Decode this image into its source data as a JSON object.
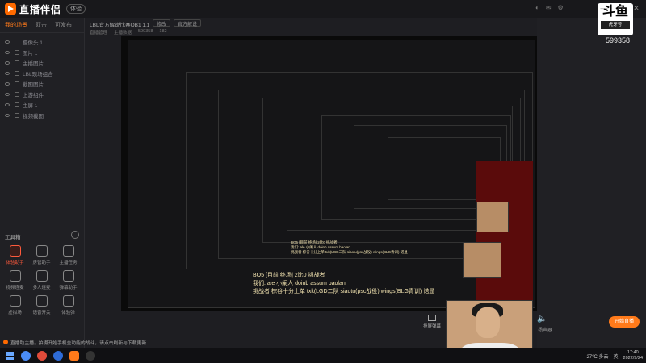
{
  "app": {
    "name": "直播伴侣",
    "badge": "体验",
    "window_controls": [
      "—",
      "□",
      "✕"
    ]
  },
  "left": {
    "tabs": [
      "我的场景",
      "双击",
      "可发布"
    ],
    "scenes": [
      "摄像头 1",
      "图片 1",
      "主播图片",
      "LBL现场组合",
      "截图图片",
      "上游组件",
      "主屏 1",
      "视频截图"
    ],
    "toolbox_title": "工具箱",
    "tools": [
      "体验助手",
      "房管助手",
      "主播任务",
      "视频连麦",
      "多人连麦",
      "弹幕助手",
      "虚拟场",
      "语音开关",
      "体验弹"
    ]
  },
  "center": {
    "room_title": "LBL官方解说比赛OB1 1.1",
    "room_btn1": "修改",
    "room_btn2": "官方解说",
    "room_sub": [
      "直播管理",
      "主播数据",
      "599358",
      "182"
    ],
    "overlay_lines": [
      "BO5 [目前 终场] 2比0 挑战者",
      "我们: ale 小阑人 doinb assum baolan",
      "挑战者 棕谷十分上单 txk(LGD二队  siaotu(psc战役) wings(BLG青训) 诺显"
    ],
    "cast_label": "投屏弹幕"
  },
  "right": {
    "logo": "斗鱼",
    "logo_sub": "虎牙号",
    "room_id": "599358",
    "volume_label": "扬声器",
    "go_live": "开始直播"
  },
  "notice": "直播助主播。拍摄开始手机全功能的战斗，请点击刷新与下载更新",
  "taskbar": {
    "weather": "27°C 多云",
    "lang": "英",
    "time": "17:40",
    "date": "2022/9/24"
  }
}
